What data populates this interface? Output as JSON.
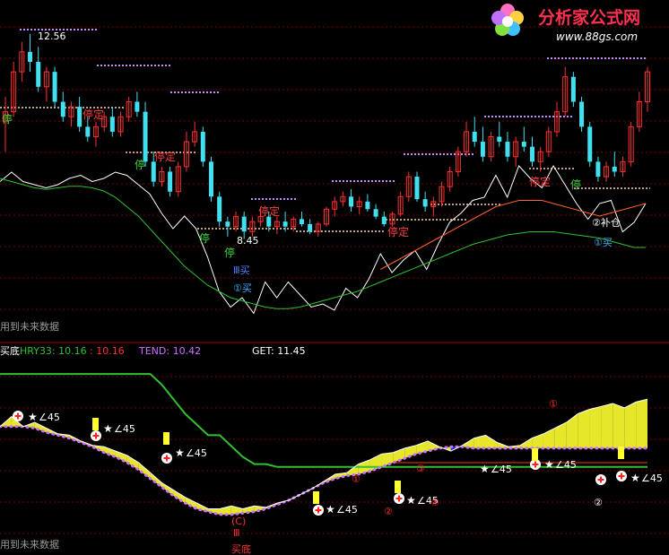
{
  "watermark": {
    "brand": "分析家公式网",
    "url": "www.88gs.com"
  },
  "colors": {
    "bg": "#000000",
    "grid": "#7a0000",
    "up": "#ff3030",
    "down": "#40e0f0",
    "green": "#30c030",
    "pink": "#e070ff",
    "yellow": "#ffff30",
    "blue": "#1e3cff",
    "stop_red": "#ff4040",
    "stop_green": "#40d040"
  },
  "upper": {
    "price_high_label": "12.56",
    "price_low_label": "8.45",
    "future_note": "用到未来数据",
    "chip_markers": [
      "②补仓",
      "①买",
      "Ⅲ买",
      "①买"
    ],
    "stop_labels": [
      "停",
      "停定",
      "停",
      "停定",
      "停",
      "停",
      "停定",
      "停定",
      "停定",
      "停"
    ]
  },
  "indicator_bar": {
    "name": "买底",
    "items": [
      {
        "label": "HRY33: 10.16",
        "color": "#30c030"
      },
      {
        "label": ": 10.16",
        "color": "#ff3030"
      },
      {
        "label": "TEND: 10.42",
        "color": "#d070ff"
      },
      {
        "label": "GET: 11.45",
        "color": "#ffffff"
      }
    ]
  },
  "lower": {
    "future_note": "用到未来数据",
    "star_label": "∠45",
    "phase_labels": [
      "①",
      "②",
      "③",
      "④",
      "①",
      "②",
      "(C)",
      "Ⅲ",
      "买底"
    ]
  },
  "chart_data": [
    {
      "type": "candlestick",
      "panel": "upper",
      "candles": [
        {
          "o": 10.8,
          "h": 11.3,
          "l": 10.2,
          "c": 11.0
        },
        {
          "o": 11.0,
          "h": 12.0,
          "l": 10.9,
          "c": 11.8
        },
        {
          "o": 11.8,
          "h": 12.4,
          "l": 11.6,
          "c": 12.2
        },
        {
          "o": 12.2,
          "h": 12.56,
          "l": 11.8,
          "c": 12.0
        },
        {
          "o": 12.0,
          "h": 12.3,
          "l": 11.4,
          "c": 11.5
        },
        {
          "o": 11.5,
          "h": 11.9,
          "l": 11.2,
          "c": 11.8
        },
        {
          "o": 11.8,
          "h": 11.9,
          "l": 11.1,
          "c": 11.2
        },
        {
          "o": 11.2,
          "h": 11.4,
          "l": 10.8,
          "c": 10.9
        },
        {
          "o": 10.9,
          "h": 11.2,
          "l": 10.7,
          "c": 11.1
        },
        {
          "o": 11.1,
          "h": 11.3,
          "l": 10.6,
          "c": 10.7
        },
        {
          "o": 10.7,
          "h": 10.9,
          "l": 10.4,
          "c": 10.5
        },
        {
          "o": 10.5,
          "h": 10.8,
          "l": 10.3,
          "c": 10.7
        },
        {
          "o": 10.7,
          "h": 11.0,
          "l": 10.6,
          "c": 10.9
        },
        {
          "o": 10.9,
          "h": 11.1,
          "l": 10.5,
          "c": 10.6
        },
        {
          "o": 10.6,
          "h": 11.0,
          "l": 10.5,
          "c": 10.9
        },
        {
          "o": 10.9,
          "h": 11.3,
          "l": 10.8,
          "c": 11.2
        },
        {
          "o": 11.2,
          "h": 11.4,
          "l": 10.9,
          "c": 11.0
        },
        {
          "o": 11.0,
          "h": 11.2,
          "l": 9.9,
          "c": 10.0
        },
        {
          "o": 10.0,
          "h": 10.2,
          "l": 9.5,
          "c": 9.6
        },
        {
          "o": 9.6,
          "h": 9.9,
          "l": 9.5,
          "c": 9.8
        },
        {
          "o": 9.8,
          "h": 9.9,
          "l": 9.3,
          "c": 9.4
        },
        {
          "o": 9.4,
          "h": 10.0,
          "l": 9.3,
          "c": 9.9
        },
        {
          "o": 9.9,
          "h": 10.6,
          "l": 9.8,
          "c": 10.4
        },
        {
          "o": 10.4,
          "h": 10.8,
          "l": 10.3,
          "c": 10.6
        },
        {
          "o": 10.6,
          "h": 10.7,
          "l": 9.9,
          "c": 10.0
        },
        {
          "o": 10.0,
          "h": 10.1,
          "l": 9.2,
          "c": 9.3
        },
        {
          "o": 9.3,
          "h": 9.4,
          "l": 8.7,
          "c": 8.8
        },
        {
          "o": 8.8,
          "h": 8.9,
          "l": 8.5,
          "c": 8.7
        },
        {
          "o": 8.7,
          "h": 9.0,
          "l": 8.6,
          "c": 8.9
        },
        {
          "o": 8.9,
          "h": 9.0,
          "l": 8.45,
          "c": 8.6
        },
        {
          "o": 8.6,
          "h": 8.9,
          "l": 8.5,
          "c": 8.8
        },
        {
          "o": 8.8,
          "h": 9.1,
          "l": 8.7,
          "c": 8.9
        },
        {
          "o": 8.9,
          "h": 9.0,
          "l": 8.6,
          "c": 8.7
        },
        {
          "o": 8.7,
          "h": 8.9,
          "l": 8.55,
          "c": 8.8
        },
        {
          "o": 8.8,
          "h": 9.0,
          "l": 8.6,
          "c": 8.7
        },
        {
          "o": 8.7,
          "h": 8.9,
          "l": 8.6,
          "c": 8.85
        },
        {
          "o": 8.85,
          "h": 9.0,
          "l": 8.7,
          "c": 8.75
        },
        {
          "o": 8.75,
          "h": 8.85,
          "l": 8.55,
          "c": 8.6
        },
        {
          "o": 8.6,
          "h": 8.8,
          "l": 8.5,
          "c": 8.75
        },
        {
          "o": 8.75,
          "h": 9.1,
          "l": 8.7,
          "c": 9.05
        },
        {
          "o": 9.05,
          "h": 9.3,
          "l": 8.9,
          "c": 9.2
        },
        {
          "o": 9.2,
          "h": 9.4,
          "l": 9.1,
          "c": 9.3
        },
        {
          "o": 9.3,
          "h": 9.45,
          "l": 9.0,
          "c": 9.1
        },
        {
          "o": 9.1,
          "h": 9.3,
          "l": 8.95,
          "c": 9.2
        },
        {
          "o": 9.2,
          "h": 9.35,
          "l": 9.0,
          "c": 9.05
        },
        {
          "o": 9.05,
          "h": 9.15,
          "l": 8.85,
          "c": 8.9
        },
        {
          "o": 8.9,
          "h": 9.0,
          "l": 8.7,
          "c": 8.75
        },
        {
          "o": 8.75,
          "h": 9.0,
          "l": 8.7,
          "c": 8.95
        },
        {
          "o": 8.95,
          "h": 9.4,
          "l": 8.9,
          "c": 9.3
        },
        {
          "o": 9.3,
          "h": 9.8,
          "l": 9.2,
          "c": 9.7
        },
        {
          "o": 9.7,
          "h": 9.8,
          "l": 9.2,
          "c": 9.25
        },
        {
          "o": 9.25,
          "h": 9.4,
          "l": 9.0,
          "c": 9.1
        },
        {
          "o": 9.1,
          "h": 9.3,
          "l": 8.9,
          "c": 9.2
        },
        {
          "o": 9.2,
          "h": 9.6,
          "l": 9.1,
          "c": 9.5
        },
        {
          "o": 9.5,
          "h": 9.9,
          "l": 9.4,
          "c": 9.8
        },
        {
          "o": 9.8,
          "h": 10.3,
          "l": 9.7,
          "c": 10.2
        },
        {
          "o": 10.2,
          "h": 10.8,
          "l": 10.1,
          "c": 10.6
        },
        {
          "o": 10.6,
          "h": 10.9,
          "l": 10.3,
          "c": 10.4
        },
        {
          "o": 10.4,
          "h": 10.7,
          "l": 10.0,
          "c": 10.1
        },
        {
          "o": 10.1,
          "h": 10.6,
          "l": 10.0,
          "c": 10.5
        },
        {
          "o": 10.5,
          "h": 10.8,
          "l": 10.3,
          "c": 10.4
        },
        {
          "o": 10.4,
          "h": 10.6,
          "l": 10.0,
          "c": 10.1
        },
        {
          "o": 10.1,
          "h": 10.5,
          "l": 9.9,
          "c": 10.4
        },
        {
          "o": 10.4,
          "h": 10.7,
          "l": 10.2,
          "c": 10.3
        },
        {
          "o": 10.3,
          "h": 10.5,
          "l": 9.9,
          "c": 10.0
        },
        {
          "o": 10.0,
          "h": 10.3,
          "l": 9.8,
          "c": 10.2
        },
        {
          "o": 10.2,
          "h": 10.7,
          "l": 10.1,
          "c": 10.6
        },
        {
          "o": 10.6,
          "h": 11.2,
          "l": 10.5,
          "c": 11.0
        },
        {
          "o": 11.0,
          "h": 11.9,
          "l": 10.9,
          "c": 11.7
        },
        {
          "o": 11.7,
          "h": 11.8,
          "l": 11.1,
          "c": 11.2
        },
        {
          "o": 11.2,
          "h": 11.3,
          "l": 10.6,
          "c": 10.7
        },
        {
          "o": 10.7,
          "h": 10.8,
          "l": 9.9,
          "c": 10.0
        },
        {
          "o": 10.0,
          "h": 10.1,
          "l": 9.6,
          "c": 9.7
        },
        {
          "o": 9.7,
          "h": 10.0,
          "l": 9.6,
          "c": 9.9
        },
        {
          "o": 9.9,
          "h": 10.2,
          "l": 9.7,
          "c": 9.8
        },
        {
          "o": 9.8,
          "h": 10.1,
          "l": 9.7,
          "c": 10.0
        },
        {
          "o": 10.0,
          "h": 10.8,
          "l": 9.9,
          "c": 10.7
        },
        {
          "o": 10.7,
          "h": 11.4,
          "l": 10.6,
          "c": 11.2
        },
        {
          "o": 11.2,
          "h": 11.9,
          "l": 11.0,
          "c": 11.8
        }
      ]
    },
    {
      "type": "line",
      "panel": "upper-oscillator",
      "series": [
        {
          "color": "#ffffff",
          "values": [
            60,
            66,
            60,
            58,
            56,
            58,
            62,
            64,
            60,
            62,
            66,
            64,
            58,
            52,
            40,
            30,
            38,
            30,
            12,
            -10,
            -20,
            -14,
            -24,
            -4,
            -14,
            -4,
            -12,
            -20,
            -18,
            -22,
            -8,
            -14,
            -2,
            14,
            2,
            10,
            16,
            4,
            20,
            34,
            40,
            48,
            50,
            64,
            50,
            70,
            62,
            56,
            70,
            58,
            46,
            36,
            46,
            48,
            28,
            34,
            46
          ]
        },
        {
          "color": "#30c030",
          "values": [
            62,
            60,
            58,
            56,
            55,
            56,
            57,
            57,
            56,
            54,
            50,
            44,
            38,
            30,
            22,
            14,
            6,
            0,
            -6,
            -10,
            -14,
            -16,
            -18,
            -20,
            -21,
            -21,
            -20,
            -18,
            -16,
            -14,
            -12,
            -10,
            -7,
            -4,
            -1,
            2,
            5,
            8,
            11,
            14,
            17,
            20,
            22,
            24,
            26,
            27,
            28,
            28,
            28,
            27,
            26,
            25,
            24,
            22,
            20,
            18,
            18
          ]
        },
        {
          "color": "#ff6030",
          "values": [
            null,
            null,
            null,
            null,
            null,
            null,
            null,
            null,
            null,
            null,
            null,
            null,
            null,
            null,
            null,
            null,
            null,
            null,
            null,
            null,
            null,
            null,
            null,
            null,
            null,
            null,
            null,
            null,
            null,
            null,
            null,
            null,
            null,
            4,
            8,
            12,
            16,
            20,
            24,
            28,
            32,
            36,
            40,
            44,
            46,
            48,
            48,
            48,
            46,
            44,
            42,
            40,
            38,
            40,
            42,
            44,
            46
          ]
        }
      ]
    },
    {
      "type": "line",
      "panel": "lower",
      "series": [
        {
          "name": "HRY33",
          "color": "#30c030",
          "values": [
            11.45,
            11.45,
            11.45,
            11.45,
            11.45,
            11.45,
            11.45,
            11.45,
            11.45,
            11.45,
            11.45,
            11.45,
            11.45,
            11.45,
            11.3,
            11.1,
            10.9,
            10.75,
            10.6,
            10.6,
            10.45,
            10.3,
            10.2,
            10.2,
            10.16,
            10.16,
            10.16,
            10.16,
            10.16,
            10.16,
            10.16,
            10.16,
            10.16,
            10.16,
            10.16,
            10.16,
            10.16,
            10.16,
            10.16,
            10.16,
            10.16,
            10.16,
            10.16,
            10.16,
            10.16,
            10.16,
            10.16,
            10.16,
            10.16,
            10.16,
            10.16,
            10.16,
            10.16,
            10.16,
            10.16,
            10.16,
            10.16
          ]
        },
        {
          "name": "TEND",
          "color": "#d070ff",
          "values": [
            10.72,
            10.72,
            10.72,
            10.7,
            10.64,
            10.6,
            10.56,
            10.5,
            10.44,
            10.36,
            10.3,
            10.22,
            10.12,
            10.0,
            9.88,
            9.76,
            9.66,
            9.58,
            9.54,
            9.5,
            9.5,
            9.52,
            9.54,
            9.58,
            9.64,
            9.7,
            9.78,
            9.86,
            9.94,
            10.0,
            10.04,
            10.06,
            10.1,
            10.16,
            10.22,
            10.28,
            10.34,
            10.38,
            10.42,
            10.44,
            10.44,
            10.42,
            10.42,
            10.42,
            10.42,
            10.42,
            10.42,
            10.42,
            10.42,
            10.42,
            10.42,
            10.42,
            10.42,
            10.42,
            10.42,
            10.42,
            10.42
          ]
        },
        {
          "name": "price",
          "color": "#ffffff",
          "values": [
            10.72,
            10.86,
            10.72,
            10.78,
            10.7,
            10.62,
            10.6,
            10.52,
            10.46,
            10.44,
            10.38,
            10.32,
            10.22,
            10.08,
            9.94,
            9.84,
            9.74,
            9.66,
            9.58,
            9.58,
            9.62,
            9.58,
            9.62,
            9.6,
            9.66,
            9.7,
            9.78,
            9.86,
            9.96,
            10.06,
            10.08,
            10.2,
            10.26,
            10.34,
            10.36,
            10.42,
            10.46,
            10.52,
            10.44,
            10.38,
            10.46,
            10.56,
            10.6,
            10.5,
            10.44,
            10.46,
            10.56,
            10.62,
            10.7,
            10.78,
            10.9,
            10.96,
            11.0,
            11.04,
            10.98,
            11.06,
            11.1
          ]
        }
      ]
    }
  ]
}
